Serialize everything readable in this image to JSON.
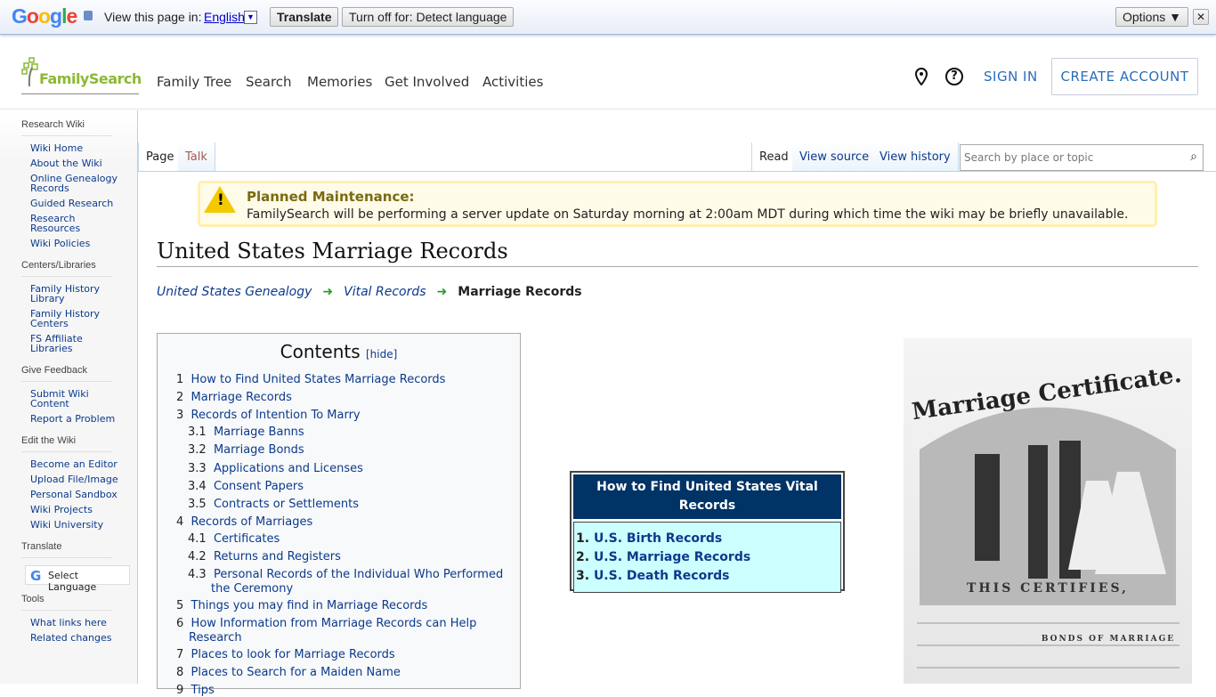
{
  "translate_bar": {
    "brand": "Google",
    "prompt": "View this page in:",
    "language": "English",
    "translate": "Translate",
    "turn_off": "Turn off for: Detect language",
    "options": "Options ▼",
    "close": "✕"
  },
  "header": {
    "logo": "FamilySearch",
    "nav": [
      "Family Tree",
      "Search",
      "Memories",
      "Get Involved",
      "Activities"
    ],
    "sign_in": "SIGN IN",
    "create_account": "CREATE ACCOUNT"
  },
  "sidebar": {
    "sections": [
      {
        "title": "Research Wiki",
        "items": [
          "Wiki Home",
          "About the Wiki",
          "Online Genealogy Records",
          "Guided Research",
          "Research Resources",
          "Wiki Policies"
        ]
      },
      {
        "title": "Centers/Libraries",
        "items": [
          "Family History Library",
          "Family History Centers",
          "FS Affiliate Libraries"
        ]
      },
      {
        "title": "Give Feedback",
        "items": [
          "Submit Wiki Content",
          "Report a Problem"
        ]
      },
      {
        "title": "Edit the Wiki",
        "items": [
          "Become an Editor",
          "Upload File/Image",
          "Personal Sandbox",
          "Wiki Projects",
          "Wiki University"
        ]
      },
      {
        "title": "Translate",
        "items": []
      },
      {
        "title": "Tools",
        "items": [
          "What links here",
          "Related changes"
        ]
      }
    ],
    "select_language": "Select Language"
  },
  "tabs": {
    "page": "Page",
    "talk": "Talk",
    "read": "Read",
    "view_source": "View source",
    "view_history": "View history"
  },
  "search": {
    "placeholder": "Search by place or topic"
  },
  "notice": {
    "title": "Planned Maintenance:",
    "body": "FamilySearch will be performing a server update on Saturday morning at 2:00am MDT during which time the wiki may be briefly unavailable."
  },
  "page_title": "United States Marriage Records",
  "breadcrumb": [
    "United States Genealogy",
    "Vital Records",
    "Marriage Records"
  ],
  "toc": {
    "title": "Contents",
    "hide": "[hide]",
    "items": [
      {
        "n": "1",
        "t": "How to Find United States Marriage Records"
      },
      {
        "n": "2",
        "t": "Marriage Records"
      },
      {
        "n": "3",
        "t": "Records of Intention To Marry"
      },
      {
        "n": "3.1",
        "t": "Marriage Banns"
      },
      {
        "n": "3.2",
        "t": "Marriage Bonds"
      },
      {
        "n": "3.3",
        "t": "Applications and Licenses"
      },
      {
        "n": "3.4",
        "t": "Consent Papers"
      },
      {
        "n": "3.5",
        "t": "Contracts or Settlements"
      },
      {
        "n": "4",
        "t": "Records of Marriages"
      },
      {
        "n": "4.1",
        "t": "Certificates"
      },
      {
        "n": "4.2",
        "t": "Returns and Registers"
      },
      {
        "n": "4.3",
        "t": "Personal Records of the Individual Who Performed",
        "t2": "the Ceremony"
      },
      {
        "n": "5",
        "t": "Things you may find in Marriage Records"
      },
      {
        "n": "6",
        "t": "How Information from Marriage Records can Help",
        "t2": "Research"
      },
      {
        "n": "7",
        "t": "Places to look for Marriage Records"
      },
      {
        "n": "8",
        "t": "Places to Search for a Maiden Name"
      },
      {
        "n": "9",
        "t": "Tips"
      }
    ]
  },
  "vital_box": {
    "title": "How to Find United States Vital Records",
    "items": [
      {
        "n": "1.",
        "t": "U.S. Birth Records"
      },
      {
        "n": "2.",
        "t": "U.S. Marriage Records"
      },
      {
        "n": "3.",
        "t": "U.S. Death Records"
      }
    ]
  },
  "certificate_image": {
    "lettering": [
      "Marriage Certificate.",
      "THIS CERTIFIES,",
      "BONDS OF MARRIAGE"
    ]
  }
}
